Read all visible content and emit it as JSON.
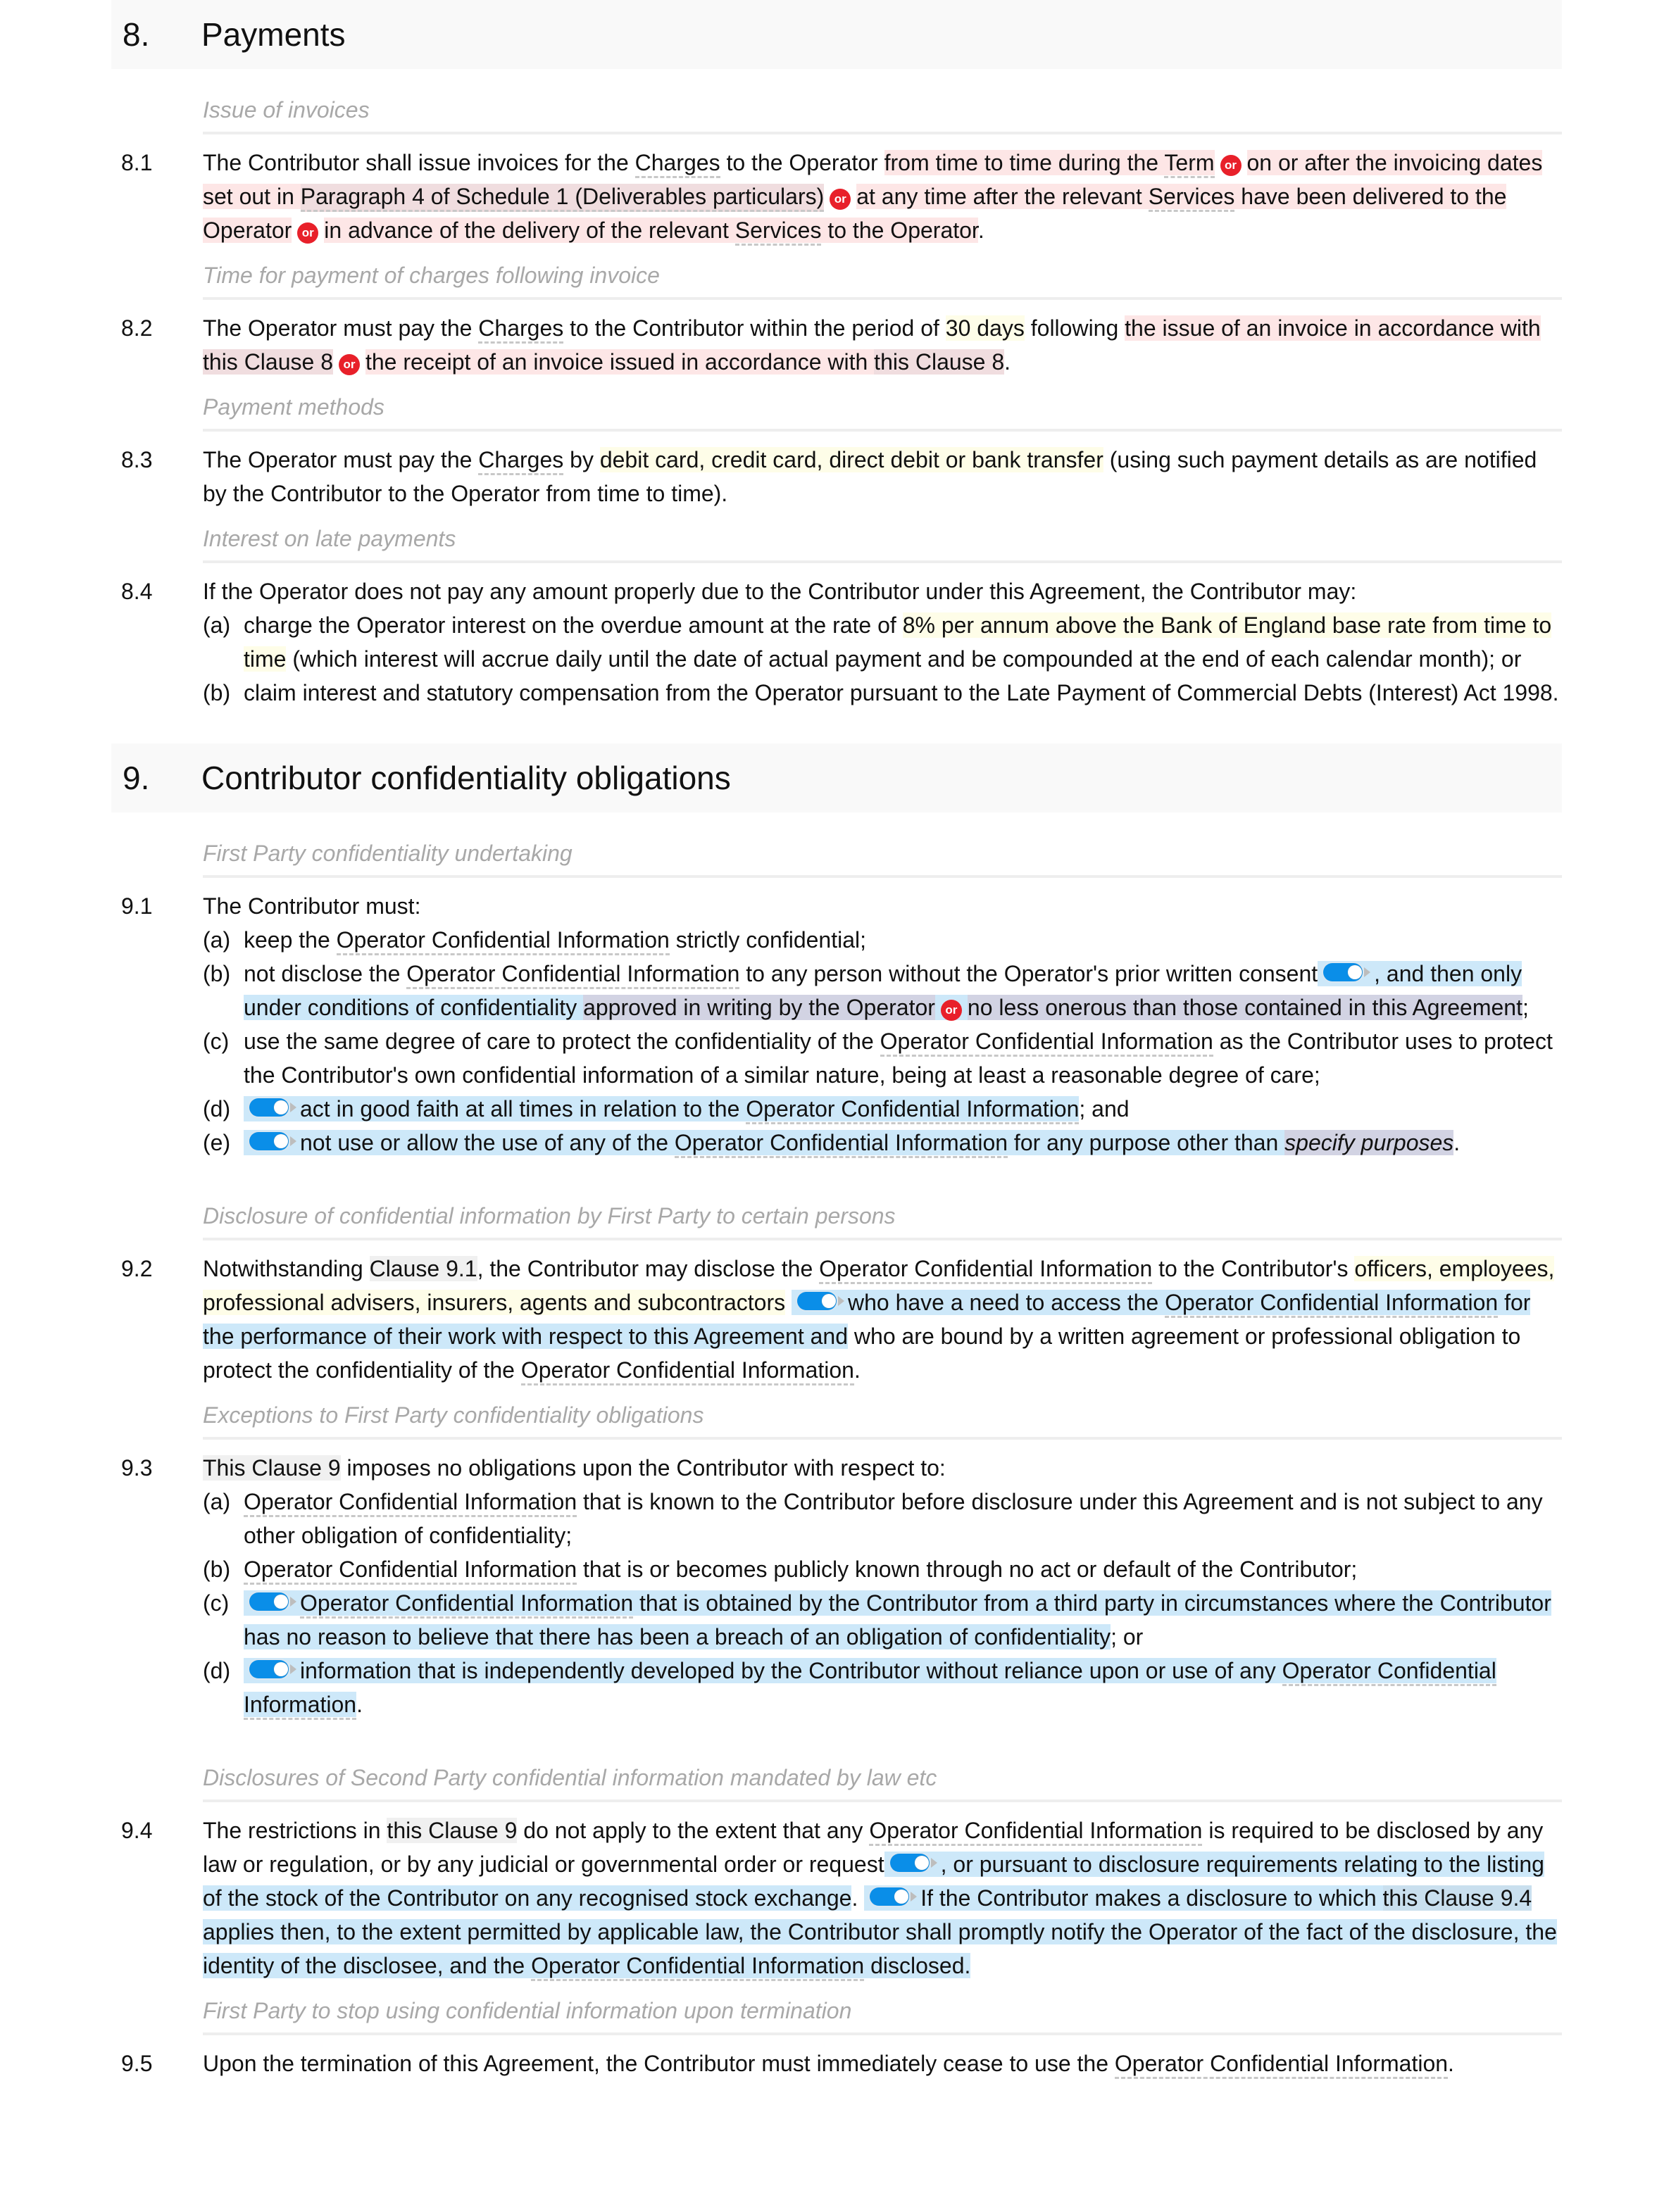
{
  "clauses": [
    {
      "number": "8.",
      "title": "Payments",
      "subheadings": {
        "s1": "Issue of invoices",
        "s2": "Time for payment of charges following invoice",
        "s3": "Payment methods",
        "s4": "Interest on late payments"
      },
      "paragraphs": {
        "p1": {
          "num": "8.1",
          "t1": "The Contributor shall issue invoices for the ",
          "t2": "Charges",
          "t3": " to the Operator ",
          "t4": "from time to time during the ",
          "t5": "Term",
          "t6": "on or after the invoicing dates set out in ",
          "t7": "Paragraph 4 of Schedule 1 (Deliverables particulars)",
          "t8": "at any time after the relevant ",
          "t9": "Services",
          "t10": " have been delivered to the Operator",
          "t11": "in advance of the delivery of the relevant ",
          "t12": "Services",
          "t13": " to the Operator",
          "t14": "."
        },
        "p2": {
          "num": "8.2",
          "t1": "The Operator must pay the ",
          "t2": "Charges",
          "t3": " to the Contributor within the period of ",
          "t4": "30 days",
          "t5": " following ",
          "t6": "the issue of an invoice in accordance with ",
          "t7": "this Clause 8",
          "t8": "the receipt of an invoice issued in accordance with ",
          "t9": "this Clause 8",
          "t10": "."
        },
        "p3": {
          "num": "8.3",
          "t1": "The Operator must pay the ",
          "t2": "Charges",
          "t3": " by ",
          "t4": "debit card, credit card, direct debit or bank transfer",
          "t5": " (using such payment details as are notified by the Contributor to the Operator from time to time)."
        },
        "p4": {
          "num": "8.4",
          "intro": "If the Operator does not pay any amount properly due to the Contributor under this Agreement, the Contributor may:",
          "a_lbl": "(a)",
          "a1": "charge the Operator interest on the overdue amount at the rate of ",
          "a2": "8% per annum above the Bank of England base rate from time to time",
          "a3": " (which interest will accrue daily until the date of actual payment and be compounded at the end of each calendar month); or",
          "b_lbl": "(b)",
          "b1": "claim interest and statutory compensation from the Operator pursuant to the Late Payment of Commercial Debts (Interest) Act 1998."
        }
      }
    },
    {
      "number": "9.",
      "title": "Contributor confidentiality obligations",
      "subheadings": {
        "s1": "First Party confidentiality undertaking",
        "s2": "Disclosure of confidential information by First Party to certain persons",
        "s3": "Exceptions to First Party confidentiality obligations",
        "s4": "Disclosures of Second Party confidential information mandated by law etc",
        "s5": "First Party to stop using confidential information upon termination"
      },
      "paragraphs": {
        "p1": {
          "num": "9.1",
          "intro": "The Contributor must:",
          "a_lbl": "(a)",
          "a1": "keep the ",
          "a2": "Operator Confidential Information",
          "a3": " strictly confidential;",
          "b_lbl": "(b)",
          "b1": "not disclose the ",
          "b2": "Operator Confidential Information",
          "b3": " to any person without the Operator's prior written consent",
          "b4": ", and then only under conditions of confidentiality ",
          "b5": "approved in writing by the Operator",
          "b6": "no less onerous than those contained in this Agreement",
          "b7": ";",
          "c_lbl": "(c)",
          "c1": "use the same degree of care to protect the confidentiality of the ",
          "c2": "Operator Confidential Information",
          "c3": " as the Contributor uses to protect the Contributor's own confidential information of a similar nature, being at least a reasonable degree of care;",
          "d_lbl": "(d)",
          "d1": "act in good faith at all times in relation to the ",
          "d2": "Operator Confidential Information",
          "d3": "; and",
          "e_lbl": "(e)",
          "e1": "not use or allow the use of any of the ",
          "e2": "Operator Confidential Information",
          "e3": " for any purpose other than ",
          "e4": "specify purposes",
          "e5": "."
        },
        "p2": {
          "num": "9.2",
          "t1": "Notwithstanding ",
          "t2": "Clause 9.1",
          "t3": ", the Contributor may disclose the ",
          "t4": "Operator Confidential Information",
          "t5": " to the Contributor's ",
          "t6": "officers, employees, professional advisers, insurers, agents and subcontractors",
          "t7": "who have a need to access the ",
          "t8": "Operator Confidential Information",
          "t9": " for the performance of their work with respect to this Agreement and",
          "t10": " who are bound by a written agreement or professional obligation to protect the confidentiality of the ",
          "t11": "Operator Confidential Information",
          "t12": "."
        },
        "p3": {
          "num": "9.3",
          "t1": "This Clause 9",
          "t2": " imposes no obligations upon the Contributor with respect to:",
          "a_lbl": "(a)",
          "a1": "Operator Confidential Information",
          "a2": " that is known to the Contributor before disclosure under this Agreement and is not subject to any other obligation of confidentiality;",
          "b_lbl": "(b)",
          "b1": "Operator Confidential Information",
          "b2": " that is or becomes publicly known through no act or default of the Contributor;",
          "c_lbl": "(c)",
          "c1": "Operator Confidential Information",
          "c2": " that is obtained by the Contributor from a third party in circumstances where the Contributor has no reason to believe that there has been a breach of an obligation of confidentiality",
          "c3": "; or",
          "d_lbl": "(d)",
          "d1": "information that is independently developed by the Contributor without reliance upon or use of any ",
          "d2": "Operator Confidential Information",
          "d3": "."
        },
        "p4": {
          "num": "9.4",
          "t1": "The restrictions in ",
          "t2": "this Clause 9",
          "t3": " do not apply to the extent that any ",
          "t4": "Operator Confidential Information",
          "t5": " is required to be disclosed by any law or regulation, or by any judicial or governmental order or request",
          "t6": ", or pursuant to disclosure requirements relating to the listing of the stock of the Contributor on any recognised stock exchange",
          "t7": ".",
          "t8": "If the Contributor makes a disclosure to which ",
          "t9": "this Clause 9.4",
          "t10": " applies then, to the extent permitted by applicable law, the Contributor shall promptly notify the Operator of the fact of the disclosure, the identity of the disclosee, and the ",
          "t11": "Operator Confidential Information",
          "t12": " disclosed."
        },
        "p5": {
          "num": "9.5",
          "t1": "Upon the termination of this Agreement, the Contributor must immediately cease to use the ",
          "t2": "Operator Confidential Information",
          "t3": "."
        }
      }
    }
  ],
  "badges": {
    "or_label": "or"
  },
  "toggles": {
    "state": "on"
  },
  "colors": {
    "or_badge": "#e8202a",
    "toggle_on": "#0a8ee8",
    "alt_highlight": "#fde6e6",
    "fill_highlight": "#fefde8",
    "optional_highlight": "#cde8f9",
    "choice_highlight": "#d2d3e3"
  }
}
